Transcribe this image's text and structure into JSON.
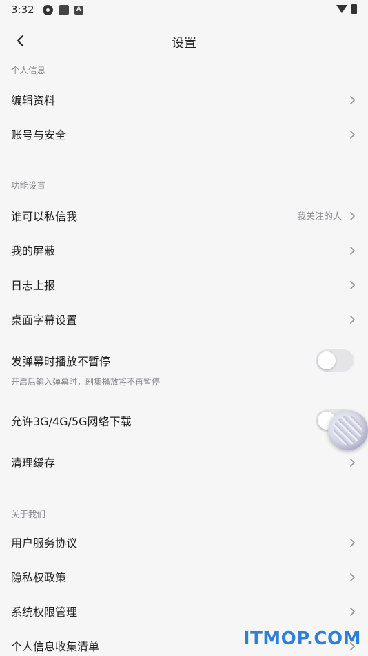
{
  "status_bar": {
    "time": "3:32",
    "a_badge": "A"
  },
  "header": {
    "title": "设置"
  },
  "sections": {
    "personal": {
      "label": "个人信息",
      "items": [
        {
          "label": "编辑资料"
        },
        {
          "label": "账号与安全"
        }
      ]
    },
    "function": {
      "label": "功能设置",
      "items": [
        {
          "label": "谁可以私信我",
          "value": "我关注的人"
        },
        {
          "label": "我的屏蔽"
        },
        {
          "label": "日志上报"
        },
        {
          "label": "桌面字幕设置"
        },
        {
          "label": "发弹幕时播放不暂停",
          "sub": "开启后输入弹幕时，剧集播放将不再暂停",
          "toggle": false
        },
        {
          "label": "允许3G/4G/5G网络下载",
          "toggle": false
        },
        {
          "label": "清理缓存"
        }
      ]
    },
    "about": {
      "label": "关于我们",
      "items": [
        {
          "label": "用户服务协议"
        },
        {
          "label": "隐私权政策"
        },
        {
          "label": "系统权限管理"
        },
        {
          "label": "个人信息收集清单"
        }
      ]
    }
  },
  "watermark": "ITMOP.COM",
  "colors": {
    "background": "#f6f6f7",
    "text": "#222222",
    "secondary_text": "#8a8a8e",
    "toggle_off": "#e5e5e8"
  }
}
